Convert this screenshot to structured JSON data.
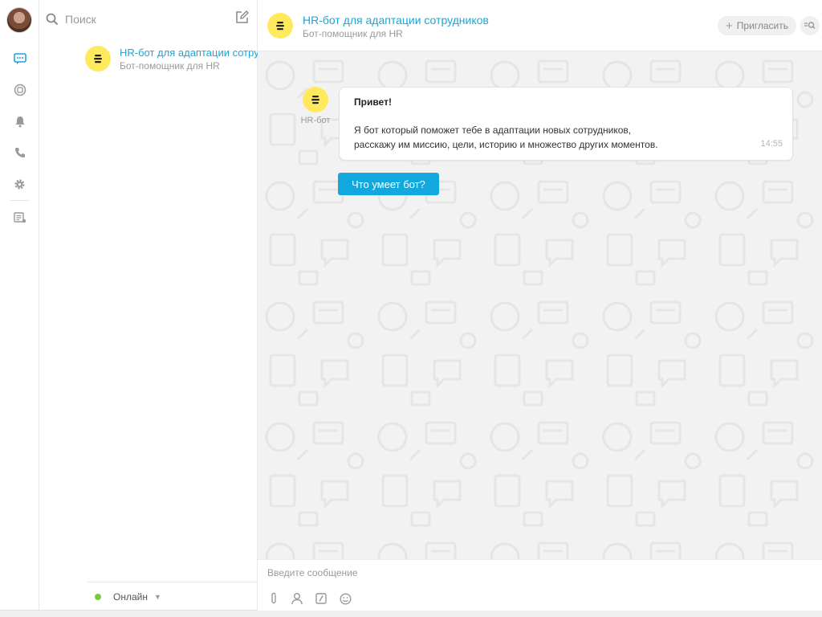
{
  "rail": {
    "items": [
      {
        "name": "chats",
        "icon": "chat-bubble-icon",
        "active": true
      },
      {
        "name": "channels",
        "icon": "channels-icon"
      },
      {
        "name": "notifications",
        "icon": "bell-icon"
      },
      {
        "name": "calls",
        "icon": "phone-icon"
      },
      {
        "name": "settings",
        "icon": "gear-icon"
      },
      {
        "name": "contacts",
        "icon": "contacts-icon"
      }
    ]
  },
  "list": {
    "search_placeholder": "Поиск",
    "chats": [
      {
        "name": "HR-бот для адаптации сотрудников",
        "subtitle": "Бот-помощник для HR"
      }
    ],
    "status_label": "Онлайн"
  },
  "chat": {
    "title": "HR-бот для адаптации сотрудников",
    "subtitle": "Бот-помощник для HR",
    "invite_label": "Пригласить",
    "message": {
      "author": "HR-бот",
      "greeting": "Привет!",
      "line1": "Я бот который поможет тебе в адаптации новых сотрудников,",
      "line2": "расскажу им миссию, цели, историю и множество других моментов.",
      "time": "14:55"
    },
    "action_button": "Что умеет бот?",
    "composer_placeholder": "Введите сообщение"
  },
  "colors": {
    "accent": "#1aa6d6",
    "button": "#12a8dd",
    "bot_avatar": "#ffe95c",
    "online": "#7cc93a"
  }
}
